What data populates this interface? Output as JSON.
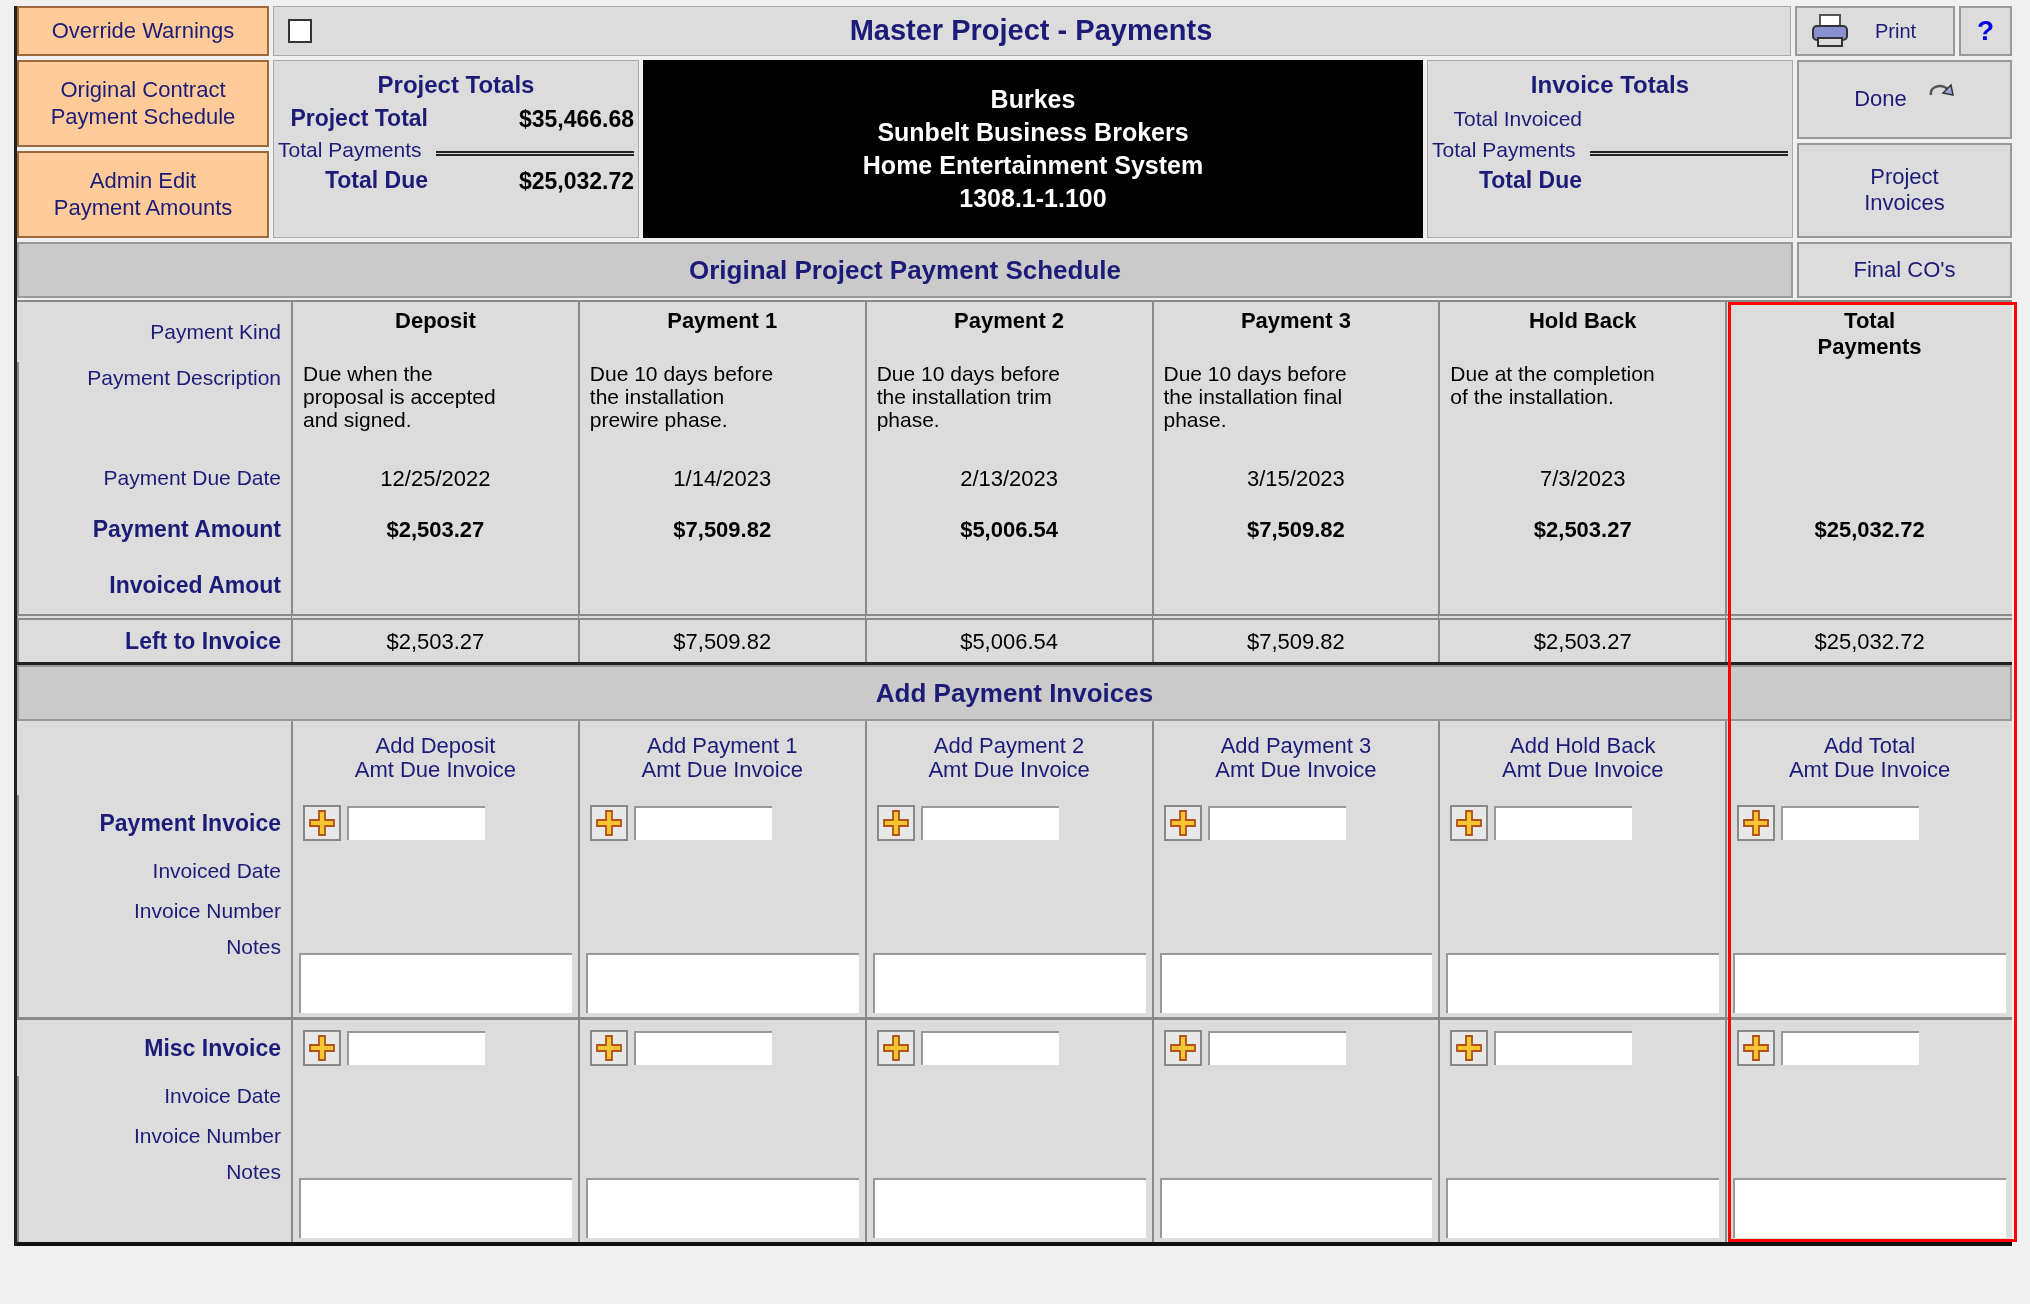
{
  "header": {
    "override": {
      "label": "Override Warnings",
      "checked": false
    },
    "title": "Master Project - Payments",
    "print": "Print",
    "help": "?"
  },
  "nav_buttons": [
    "Original Contract\nPayment Schedule",
    "Admin Edit\nPayment Amounts"
  ],
  "project_totals": {
    "title": "Project Totals",
    "rows": [
      {
        "label": "Project Total",
        "value": "$35,466.68",
        "kind": "bold"
      },
      {
        "label": "Total Payments",
        "kind": "subtotal"
      },
      {
        "label": "Total Due",
        "value": "$25,032.72",
        "kind": "total"
      }
    ]
  },
  "project_info": [
    "Burkes",
    "Sunbelt Business Brokers",
    "Home Entertainment System",
    "1308.1-1.100"
  ],
  "invoice_totals": {
    "title": "Invoice Totals",
    "rows": [
      {
        "label": "Total Invoiced",
        "kind": "plain"
      },
      {
        "label": "Total Payments",
        "kind": "subtotal"
      },
      {
        "label": "Total Due",
        "kind": "total"
      }
    ]
  },
  "side_buttons": [
    {
      "label": "Done",
      "kind": "done"
    },
    {
      "label": "Project\nInvoices",
      "kind": "plain"
    }
  ],
  "schedule": {
    "title": "Original Project Payment Schedule",
    "final_cos": "Final CO's",
    "row_labels": [
      {
        "label": "Payment Kind",
        "emphasis": false
      },
      {
        "label": "Payment Description",
        "emphasis": false
      },
      {
        "label": "Payment Due Date",
        "emphasis": false
      },
      {
        "label": "Payment Amount",
        "emphasis": true
      },
      {
        "label": "Invoiced Amout",
        "emphasis": true
      },
      {
        "label": "Left to Invoice",
        "emphasis": true
      }
    ],
    "columns": [
      {
        "name": "Deposit",
        "description": "Due when the\nproposal is accepted\nand signed.",
        "due_date": "12/25/2022",
        "amount": "$2,503.27",
        "left": "$2,503.27",
        "highlighted": false
      },
      {
        "name": "Payment 1",
        "description": "Due 10 days before\nthe installation\nprewire phase.",
        "due_date": "1/14/2023",
        "amount": "$7,509.82",
        "left": "$7,509.82",
        "highlighted": false
      },
      {
        "name": "Payment 2",
        "description": "Due 10 days before\nthe installation trim\nphase.",
        "due_date": "2/13/2023",
        "amount": "$5,006.54",
        "left": "$5,006.54",
        "highlighted": false
      },
      {
        "name": "Payment 3",
        "description": "Due 10 days before\nthe installation final\nphase.",
        "due_date": "3/15/2023",
        "amount": "$7,509.82",
        "left": "$7,509.82",
        "highlighted": false
      },
      {
        "name": "Hold Back",
        "description": "Due at the completion\nof the installation.",
        "due_date": "7/3/2023",
        "amount": "$2,503.27",
        "left": "$2,503.27",
        "highlighted": false
      },
      {
        "name": "Total\nPayments",
        "amount": "$25,032.72",
        "left": "$25,032.72",
        "highlighted": true
      }
    ]
  },
  "invoices": {
    "title": "Add Payment Invoices",
    "groups": [
      {
        "title": "Payment Invoice",
        "labels": [
          "Invoiced Date",
          "Invoice Number",
          "Notes"
        ],
        "column_headers": [
          "Add Deposit\nAmt Due Invoice",
          "Add Payment 1\nAmt Due Invoice",
          "Add Payment 2\nAmt Due Invoice",
          "Add Payment 3\nAmt Due Invoice",
          "Add Hold Back\nAmt Due Invoice",
          "Add Total\nAmt Due Invoice"
        ]
      },
      {
        "title": "Misc Invoice",
        "labels": [
          "Invoice Date",
          "Invoice Number",
          "Notes"
        ]
      }
    ]
  }
}
